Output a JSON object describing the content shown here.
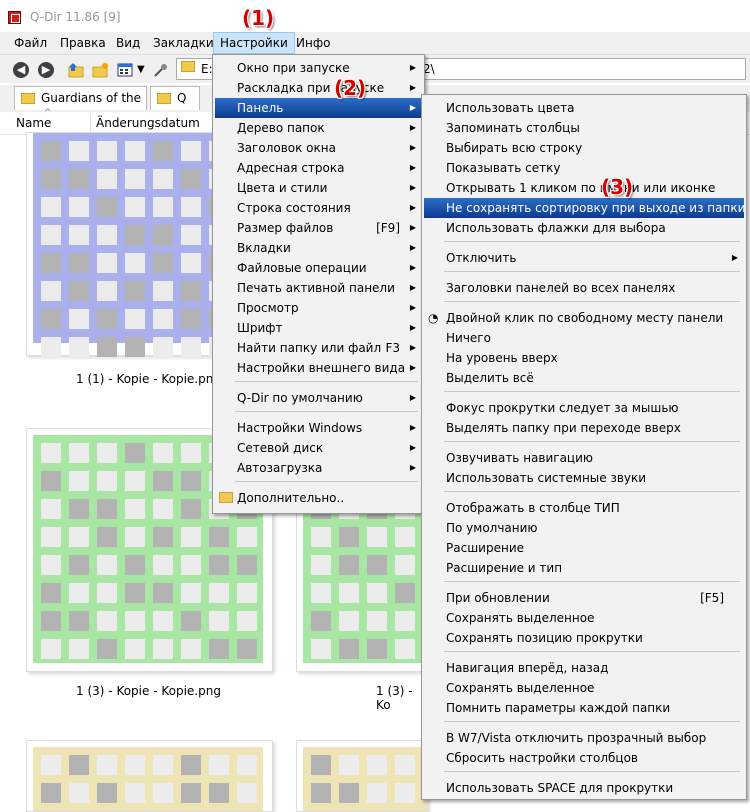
{
  "window": {
    "title": "Q-Dir 11.86 [9]"
  },
  "menubar": {
    "items": [
      "Файл",
      "Правка",
      "Вид",
      "Закладки",
      "Настройки",
      "Инфо"
    ]
  },
  "address": {
    "left": "E:\\",
    "right": "2\\"
  },
  "tabs": [
    {
      "label": "Guardians of the ..."
    },
    {
      "label": "Q"
    }
  ],
  "columns": {
    "name": "Name",
    "date": "Änderungsdatum"
  },
  "thumbnails": [
    {
      "label": "1 (1) - Kopie - Kopie.png",
      "color": "#aab0ec"
    },
    {
      "label": "1 (3) - Kopie - Kopie.png",
      "color": "#a8e6a4"
    },
    {
      "label": "1 (3) - Ko",
      "color": "#a8e6a4"
    },
    {
      "label": "",
      "color": "#eee4b4"
    },
    {
      "label": "",
      "color": "#eee4b4"
    }
  ],
  "callouts": [
    "(1)",
    "(2)",
    "(3)"
  ],
  "settings_menu": {
    "items": [
      {
        "label": "Окно при запуске",
        "submenu": true
      },
      {
        "label": "Раскладка при запуске",
        "submenu": true
      },
      {
        "label": "Панель",
        "submenu": true,
        "highlighted": true
      },
      {
        "label": "Дерево папок",
        "submenu": true
      },
      {
        "label": "Заголовок окна",
        "submenu": true
      },
      {
        "label": "Адресная строка",
        "submenu": true
      },
      {
        "label": "Цвета и стили",
        "submenu": true
      },
      {
        "label": "Строка состояния",
        "submenu": true
      },
      {
        "label": "Размер файлов",
        "shortcut": "[F9]",
        "submenu": true
      },
      {
        "label": "Вкладки",
        "submenu": true
      },
      {
        "label": "Файловые операции",
        "submenu": true
      },
      {
        "label": "Печать активной панели",
        "submenu": true
      },
      {
        "label": "Просмотр",
        "submenu": true
      },
      {
        "label": "Шрифт",
        "submenu": true
      },
      {
        "label": "Найти папку или файл",
        "shortcut": "F3",
        "submenu": true
      },
      {
        "label": "Настройки внешнего вида",
        "submenu": true
      },
      {
        "label": "Q-Dir по умолчанию",
        "submenu": true
      },
      {
        "label": "Настройки Windows",
        "submenu": true
      },
      {
        "label": "Сетевой диск",
        "submenu": true
      },
      {
        "label": "Автозагрузка",
        "submenu": true
      },
      {
        "label": "Дополнительно..",
        "submenu": false
      }
    ]
  },
  "panel_menu": {
    "items": [
      "Использовать цвета",
      "Запоминать столбцы",
      "Выбирать всю строку",
      "Показывать сетку",
      "Открывать 1 кликом по имени или иконке",
      "Не сохранять сортировку при выходе из папки",
      "Использовать флажки для выбора",
      "Отключить",
      "Заголовки панелей во всех панелях",
      "Двойной клик по свободному месту панели",
      "Ничего",
      "На уровень вверх",
      "Выделить всё",
      "Фокус прокрутки следует за мышью",
      "Выделять папку при переходе вверх",
      "Озвучивать навигацию",
      "Использовать системные звуки",
      "Отображать в столбце ТИП",
      "По умолчанию",
      "Расширение",
      "Расширение и тип",
      "При обновлении",
      "Сохранять выделенное",
      "Сохранять позицию прокрутки",
      "Навигация вперёд, назад",
      "Сохранять выделенное",
      "Помнить параметры каждой папки",
      "В W7/Vista отключить прозрачный выбор",
      "Сбросить настройки столбцов",
      "Использовать SPACE для прокрутки"
    ],
    "refresh_shortcut": "[F5]"
  }
}
